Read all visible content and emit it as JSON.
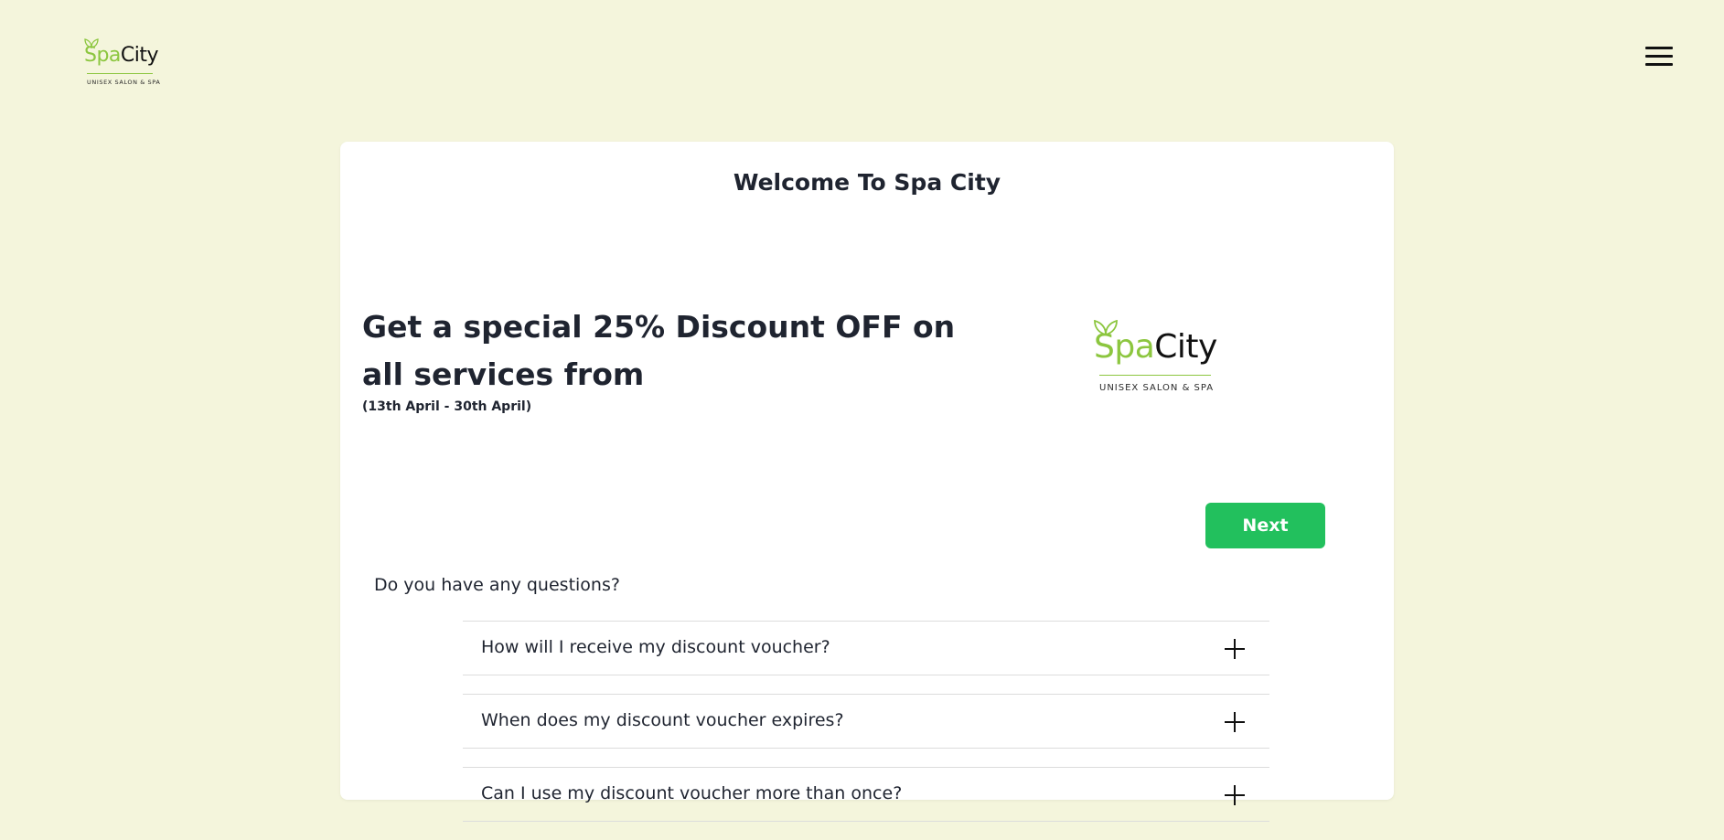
{
  "header": {
    "logo": {
      "brand_first": "Spa",
      "brand_second": "City",
      "tagline": "UNISEX SALON & SPA",
      "leaf_icon": "leaf-icon"
    },
    "menu_icon": "hamburger-menu-icon"
  },
  "card": {
    "title": "Welcome To Spa City",
    "promo": {
      "headline": "Get a special 25% Discount OFF on all services from",
      "dates": "(13th April - 30th April)"
    },
    "logo": {
      "brand_first": "Spa",
      "brand_second": "City",
      "tagline": "UNISEX SALON & SPA"
    },
    "next_label": "Next",
    "faq": {
      "heading": "Do you have any questions?",
      "items": [
        {
          "question": "How will I receive my discount voucher?",
          "icon": "plus-icon"
        },
        {
          "question": "When does my discount voucher expires?",
          "icon": "plus-icon"
        },
        {
          "question": "Can I use my discount voucher more than once?",
          "icon": "plus-icon"
        }
      ]
    }
  },
  "colors": {
    "page_background": "#f4f5dc",
    "card_background": "#ffffff",
    "brand_green": "#8cc63f",
    "button_green": "#22c05d",
    "text_dark": "#1f2430"
  }
}
